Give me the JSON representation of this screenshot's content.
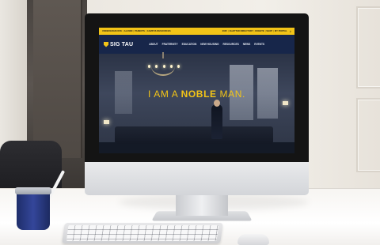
{
  "website": {
    "utility_links_left": [
      "UNDERGRADUATE",
      "ALUMNI",
      "PARENTS",
      "CAMPUS RESOURCES"
    ],
    "utility_links_right": [
      "2025",
      "CHAPTER DIRECTORY",
      "DONATE",
      "SHOP",
      "MY PORTAL"
    ],
    "logo_text": "SIG TAU",
    "nav_items": [
      "ABOUT",
      "FRATERNITY",
      "EDUCATION",
      "NEW HOUSING",
      "RESOURCES",
      "NEWS",
      "EVENTS"
    ],
    "hero": {
      "prefix": "I AM A ",
      "emphasis": "NOBLE",
      "suffix": " MAN."
    },
    "accent_color": "#f2c417",
    "nav_color": "#17264a"
  },
  "icons": {
    "search": "search-icon",
    "logo_shield": "shield-icon"
  }
}
